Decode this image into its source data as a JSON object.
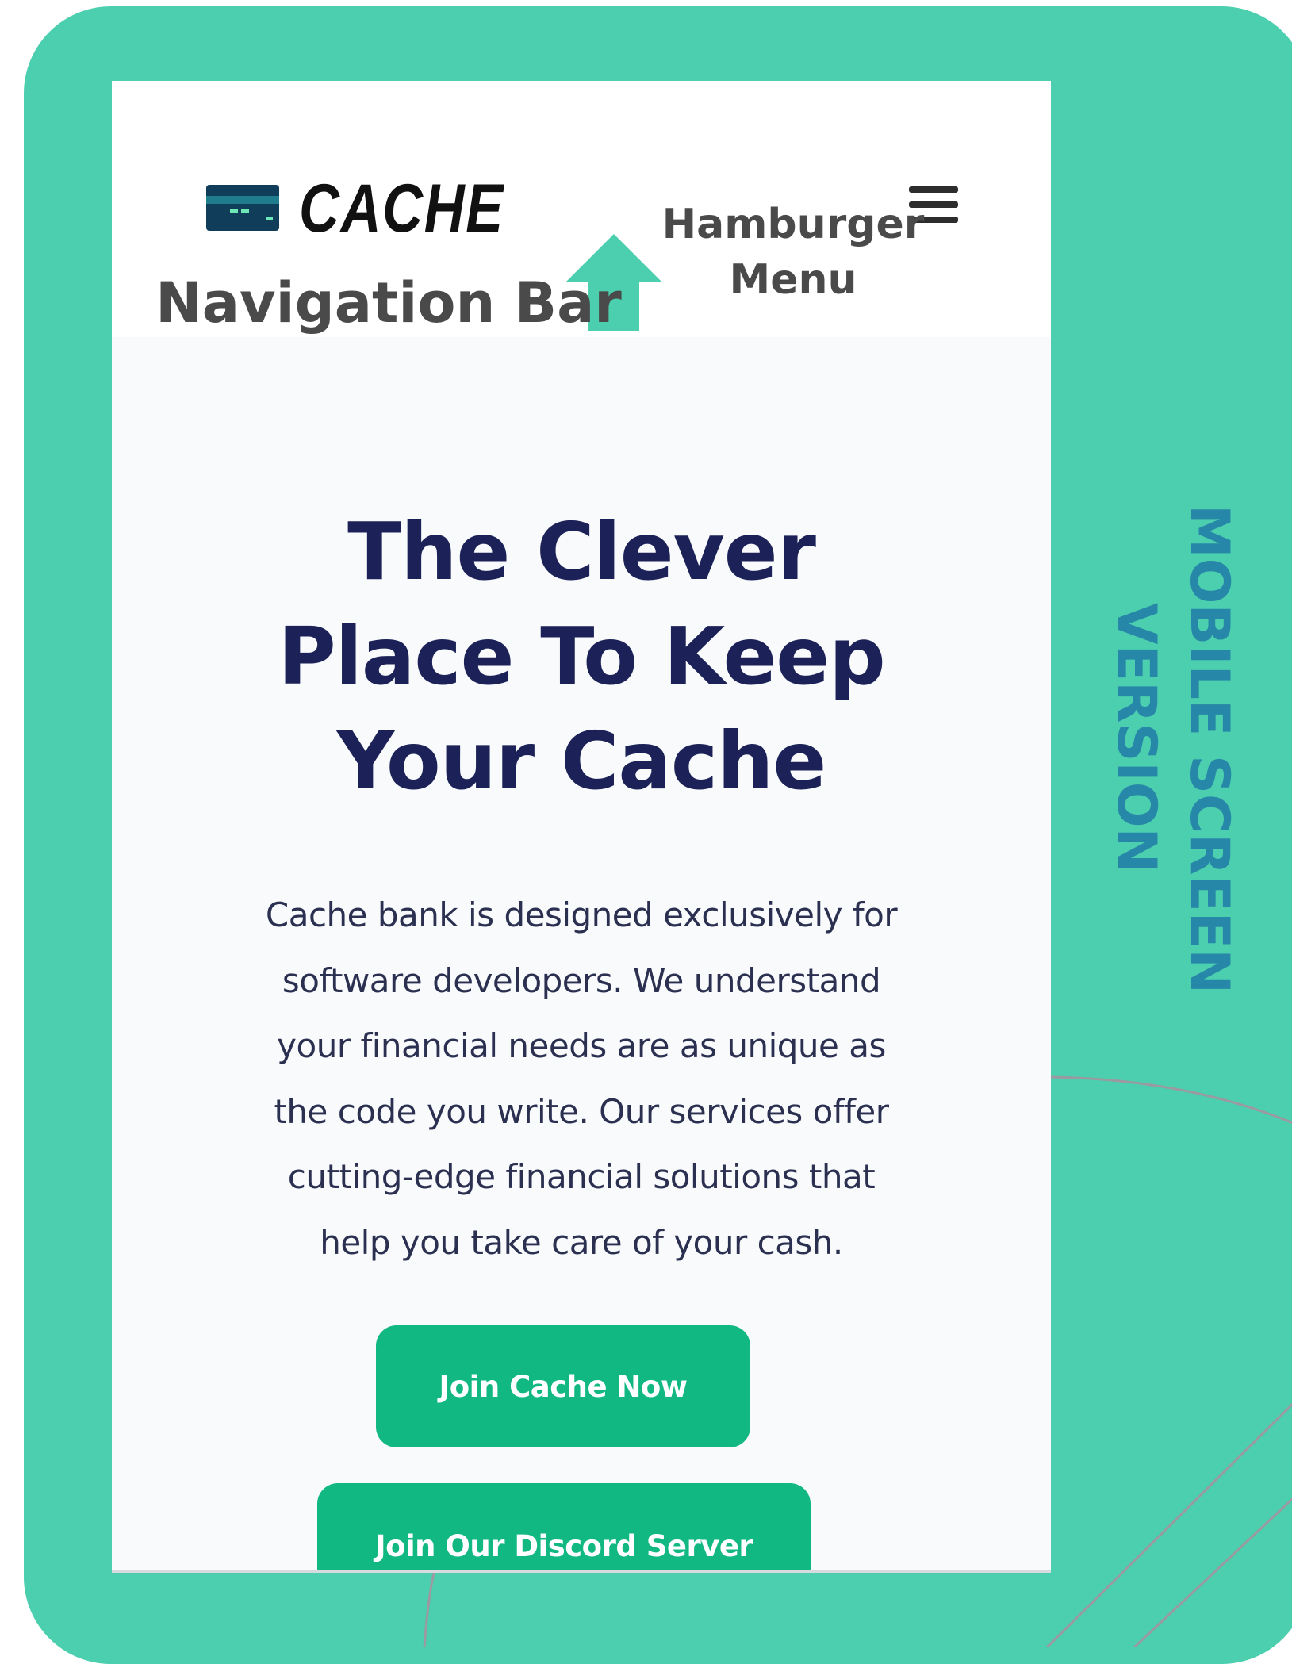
{
  "colors": {
    "frame": "#4bcfae",
    "nav_background": "#ffffff",
    "page_background": "#f8fafc",
    "heading": "#1c2257",
    "body_text": "#2b3051",
    "button": "#12b882",
    "side_label": "#2787a8",
    "annotation": "#4a4a4a"
  },
  "navbar": {
    "logo_icon": "credit-card-icon",
    "logo_text": "CACHE",
    "menu_icon": "hamburger-menu-icon"
  },
  "annotations": {
    "hamburger_line1": "Hamburger",
    "hamburger_line2": "Menu",
    "navigation": "Navigation Bar",
    "arrow_icon": "up-arrow-icon"
  },
  "hero": {
    "title_line1": "The Clever",
    "title_line2": "Place To Keep",
    "title_line3": "Your Cache",
    "description": [
      "Cache bank is designed exclusively for",
      "software developers. We understand",
      "your financial needs are as unique as",
      "the code you write. Our services offer",
      "cutting-edge financial solutions that",
      "help you take care of your cash."
    ]
  },
  "buttons": {
    "join": "Join Cache Now",
    "discord": "Join Our Discord Server"
  },
  "side_label": {
    "line1": "MOBILE SCREEN",
    "line2": "VERSION"
  }
}
